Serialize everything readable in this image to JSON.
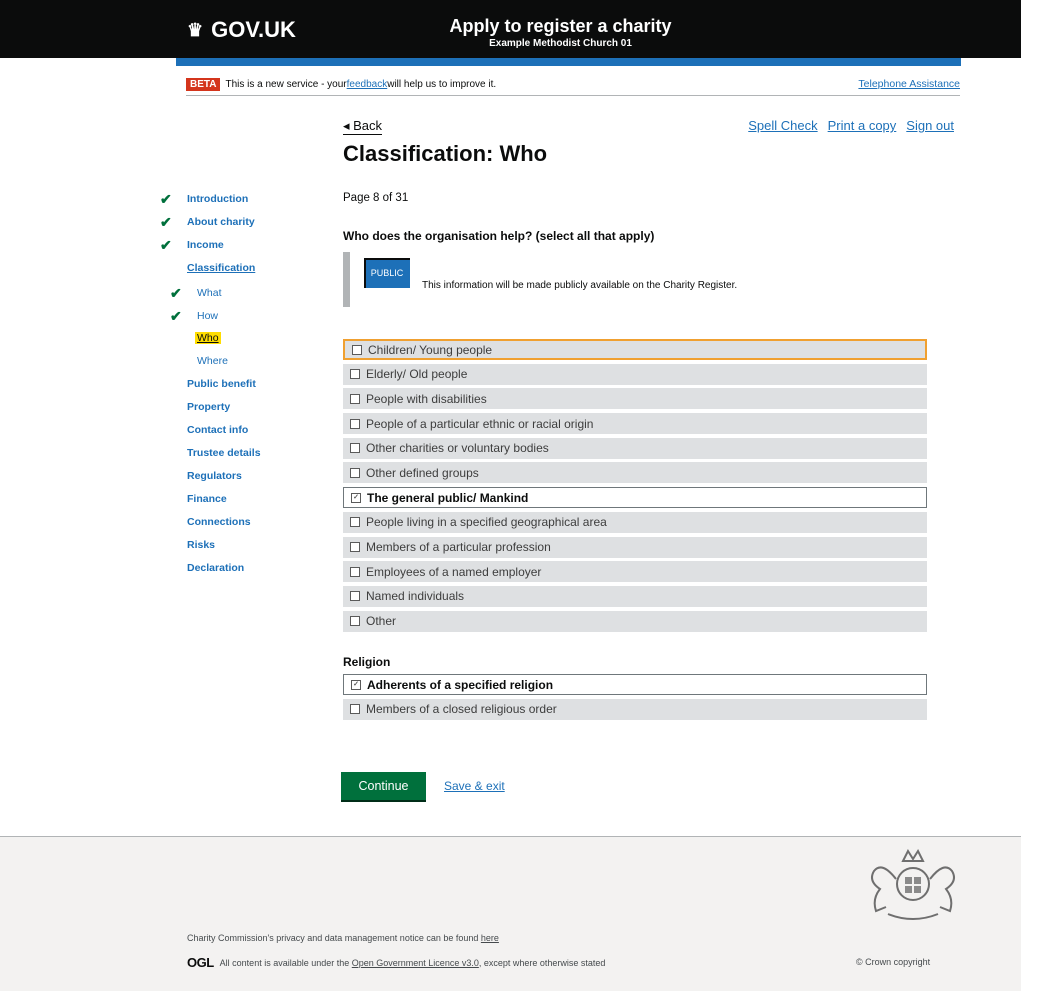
{
  "header": {
    "logo_text": "GOV.UK",
    "service_title": "Apply to register a charity",
    "service_subtitle": "Example Methodist Church 01"
  },
  "beta": {
    "tag": "BETA",
    "text_before": "This is a new service - your ",
    "feedback_link": "feedback",
    "text_after": " will help us to improve it.",
    "telephone_link": "Telephone Assistance"
  },
  "nav_top": {
    "back": "◂ Back",
    "spell_check": "Spell Check",
    "print": "Print a copy",
    "sign_out": "Sign out"
  },
  "page": {
    "title": "Classification: Who",
    "page_count": "Page 8 of 31",
    "question": "Who does the organisation help? (select all that apply)",
    "public_badge": "PUBLIC",
    "notice": "This information will be made publicly available on the Charity Register."
  },
  "sidebar": [
    {
      "label": "Introduction",
      "done": true,
      "sub": false
    },
    {
      "label": "About charity",
      "done": true,
      "sub": false
    },
    {
      "label": "Income",
      "done": true,
      "sub": false
    },
    {
      "label": "Classification",
      "done": false,
      "sub": false
    },
    {
      "label": "What",
      "done": true,
      "sub": true
    },
    {
      "label": "How",
      "done": true,
      "sub": true
    },
    {
      "label": "Who",
      "done": false,
      "sub": true,
      "current": true
    },
    {
      "label": "Where",
      "done": false,
      "sub": true
    },
    {
      "label": "Public benefit",
      "done": false,
      "sub": false
    },
    {
      "label": "Property",
      "done": false,
      "sub": false
    },
    {
      "label": "Contact info",
      "done": false,
      "sub": false
    },
    {
      "label": "Trustee details",
      "done": false,
      "sub": false
    },
    {
      "label": "Regulators",
      "done": false,
      "sub": false
    },
    {
      "label": "Finance",
      "done": false,
      "sub": false
    },
    {
      "label": "Connections",
      "done": false,
      "sub": false
    },
    {
      "label": "Risks",
      "done": false,
      "sub": false
    },
    {
      "label": "Declaration",
      "done": false,
      "sub": false
    }
  ],
  "who_options": [
    {
      "label": "Children/ Young people",
      "checked": false,
      "focused": true
    },
    {
      "label": "Elderly/ Old people",
      "checked": false
    },
    {
      "label": "People with disabilities",
      "checked": false
    },
    {
      "label": "People of a particular ethnic or racial origin",
      "checked": false
    },
    {
      "label": "Other charities or voluntary bodies",
      "checked": false
    },
    {
      "label": "Other defined groups",
      "checked": false
    },
    {
      "label": "The general public/ Mankind",
      "checked": true
    },
    {
      "label": "People living in a specified geographical area",
      "checked": false
    },
    {
      "label": "Members of a particular profession",
      "checked": false
    },
    {
      "label": "Employees of a named employer",
      "checked": false
    },
    {
      "label": "Named individuals",
      "checked": false
    },
    {
      "label": "Other",
      "checked": false
    }
  ],
  "religion": {
    "heading": "Religion",
    "options": [
      {
        "label": "Adherents of a specified religion",
        "checked": true
      },
      {
        "label": "Members of a closed religious order",
        "checked": false
      }
    ]
  },
  "actions": {
    "continue": "Continue",
    "save_exit": "Save & exit"
  },
  "footer": {
    "privacy_text": "Charity Commission's privacy and data management notice can be found ",
    "privacy_link": "here",
    "ogl_logo": "OGL",
    "licence_before": "All content is available under the ",
    "licence_link": "Open Government Licence v3.0",
    "licence_after": ", except where otherwise stated",
    "copyright": "© Crown copyright"
  },
  "colors": {
    "header_bg": "#0b0c0c",
    "brand_blue": "#1d70b8",
    "beta_red": "#d4351c",
    "button_green": "#00703c",
    "focus_yellow": "#ffdd00"
  }
}
